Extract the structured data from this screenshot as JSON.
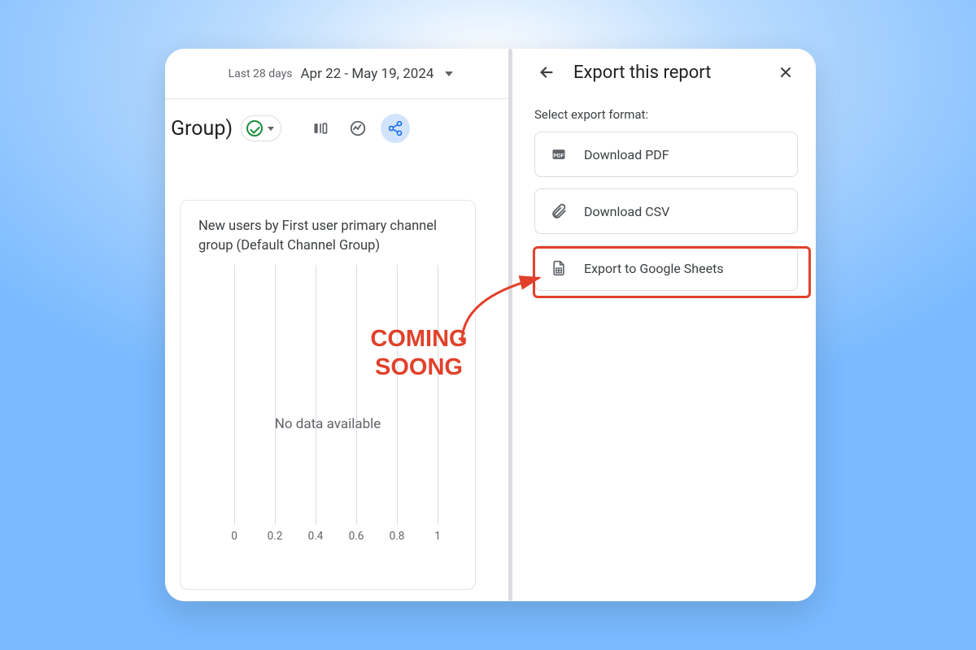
{
  "date_picker": {
    "preset": "Last 28 days",
    "range": "Apr 22 - May 19, 2024"
  },
  "report": {
    "title_suffix": "ult Channel Group)",
    "card_title": "New users by First user primary channel group (Default Channel Group)",
    "no_data": "No data available",
    "x_ticks": [
      "0",
      "0.2",
      "0.4",
      "0.6",
      "0.8",
      "1"
    ]
  },
  "export_panel": {
    "title": "Export this report",
    "subtitle": "Select export format:",
    "options": {
      "pdf": "Download PDF",
      "csv": "Download CSV",
      "sheets": "Export to Google Sheets"
    }
  },
  "annotation": {
    "text": "COMING SOONG"
  }
}
